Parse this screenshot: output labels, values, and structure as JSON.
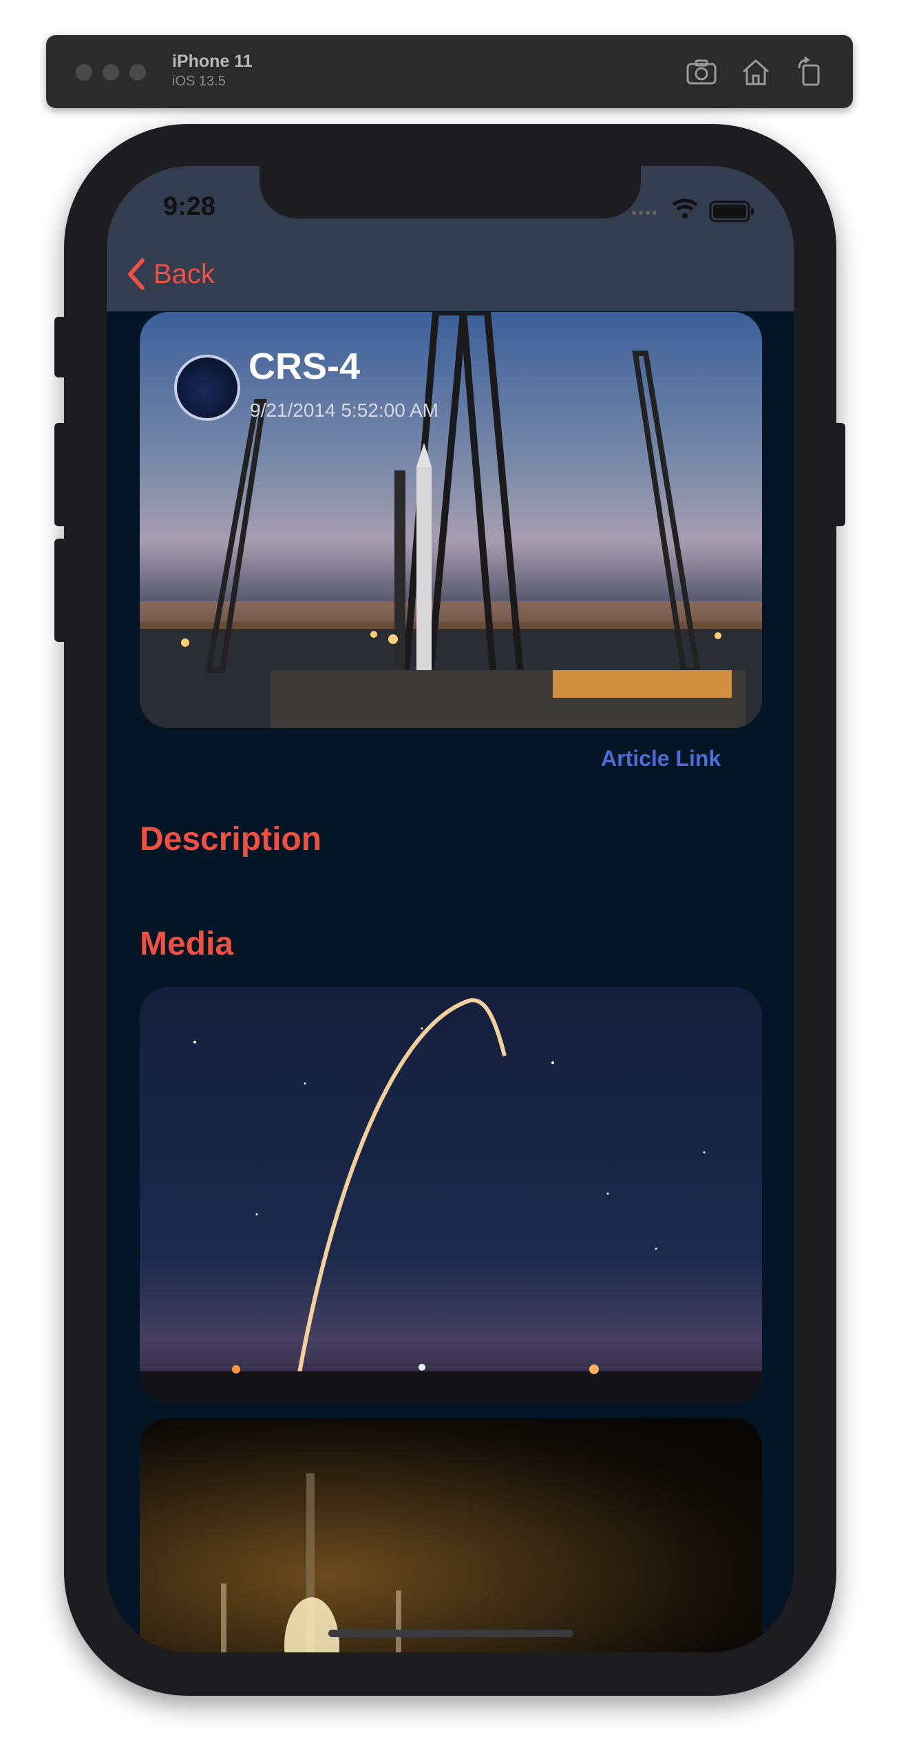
{
  "simulator": {
    "device_name": "iPhone 11",
    "os_version": "iOS 13.5",
    "buttons": [
      {
        "name": "screenshot-icon"
      },
      {
        "name": "home-icon"
      },
      {
        "name": "rotate-icon"
      }
    ]
  },
  "status_bar": {
    "time": "9:28",
    "icons": [
      "signal-icon",
      "wifi-icon",
      "battery-icon"
    ]
  },
  "nav": {
    "back_label": "Back"
  },
  "launch": {
    "name": "CRS-4",
    "date": "9/21/2014 5:52:00 AM",
    "patch_icon": "mission-patch"
  },
  "links": {
    "article_label": "Article Link"
  },
  "sections": {
    "description": "Description",
    "media": "Media"
  },
  "colors": {
    "accent": "#f0503f",
    "link": "#4d6cd8",
    "background": "#041526",
    "navbar": "#333d50"
  }
}
